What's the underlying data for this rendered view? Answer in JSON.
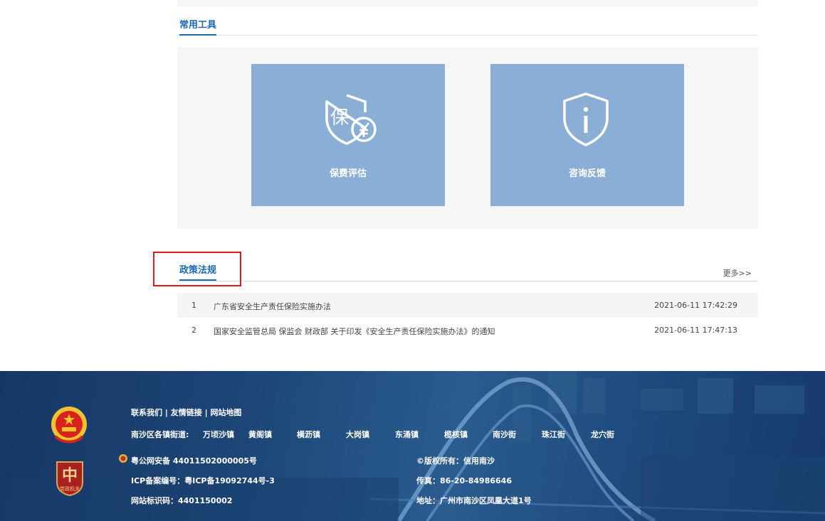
{
  "tools": {
    "title": "常用工具",
    "cards": [
      {
        "label": "保费评估",
        "icon": "shield-yen-icon"
      },
      {
        "label": "咨询反馈",
        "icon": "shield-info-icon"
      }
    ]
  },
  "policy": {
    "title": "政策法规",
    "more": "更多>>",
    "rows": [
      {
        "num": "1",
        "title": "广东省安全生产责任保险实施办法",
        "date": "2021-06-11 17:42:29"
      },
      {
        "num": "2",
        "title": "国家安全监管总局 保监会 财政部 关于印发《安全生产责任保险实施办法》的通知",
        "date": "2021-06-11 17:47:13"
      }
    ]
  },
  "footer": {
    "links": {
      "contact": "联系我们",
      "sep1": "|",
      "friends": "友情链接",
      "sep2": "|",
      "sitemap": "网站地图"
    },
    "towns_label": "南沙区各镇街道:",
    "towns": [
      "万顷沙镇",
      "黄阁镇",
      "横沥镇",
      "大岗镇",
      "东涌镇",
      "榄核镇",
      "南沙街",
      "珠江街",
      "龙穴街"
    ],
    "police_record": "粤公网安备 44011502000005号",
    "icp": "ICP备案编号：粤ICP备19092744号-3",
    "site_code": "网站标识码：4401150002",
    "copyright": "©版权所有：信用南沙",
    "fax": "传真：86-20-84986646",
    "address": "地址：广州市南沙区凤凰大道1号",
    "badge_text": "党政机关",
    "badge_char": "中"
  },
  "colors": {
    "accent": "#1a68b6",
    "card": "#8aaed6",
    "footer": "#1d4677",
    "highlight": "#e1191f"
  }
}
